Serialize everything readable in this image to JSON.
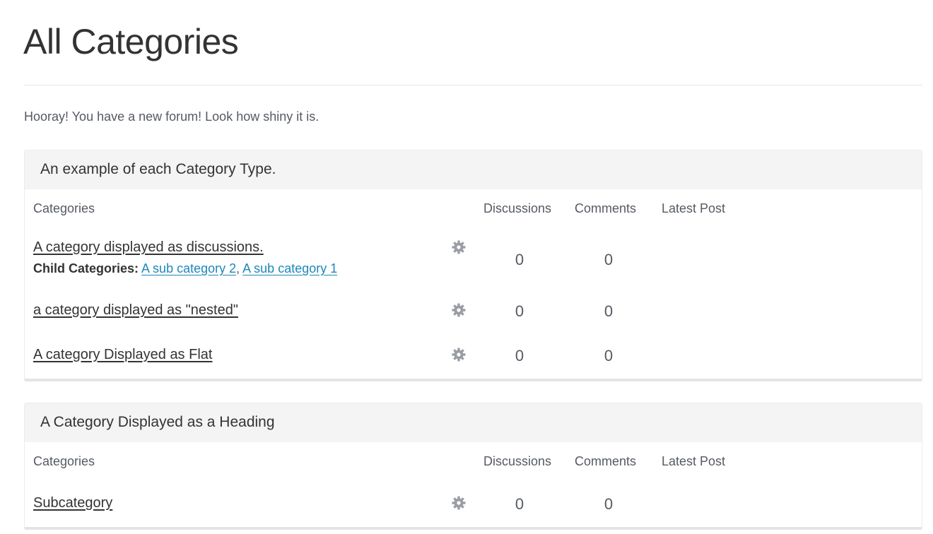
{
  "page": {
    "title": "All Categories",
    "description": "Hooray! You have a new forum! Look how shiny it is."
  },
  "columns": {
    "categories": "Categories",
    "discussions": "Discussions",
    "comments": "Comments",
    "latest_post": "Latest Post"
  },
  "tables": [
    {
      "heading": "An example of each Category Type.",
      "rows": [
        {
          "name": "A category displayed as discussions.",
          "child_label": "Child Categories:",
          "children": [
            "A sub category 2",
            "A sub category 1"
          ],
          "discussions": "0",
          "comments": "0",
          "options_icon": "gear-icon"
        },
        {
          "name": "a category displayed as \"nested\"",
          "discussions": "0",
          "comments": "0",
          "options_icon": "gear-icon"
        },
        {
          "name": "A category Displayed as Flat",
          "discussions": "0",
          "comments": "0",
          "options_icon": "gear-icon"
        }
      ]
    },
    {
      "heading": "A Category Displayed as a Heading",
      "rows": [
        {
          "name": "Subcategory",
          "discussions": "0",
          "comments": "0",
          "options_icon": "gear-icon"
        }
      ]
    }
  ],
  "separator": ", ",
  "colors": {
    "link": "#1e87b9",
    "heading_bg": "#f4f4f4",
    "gear": "#9a9da3"
  }
}
